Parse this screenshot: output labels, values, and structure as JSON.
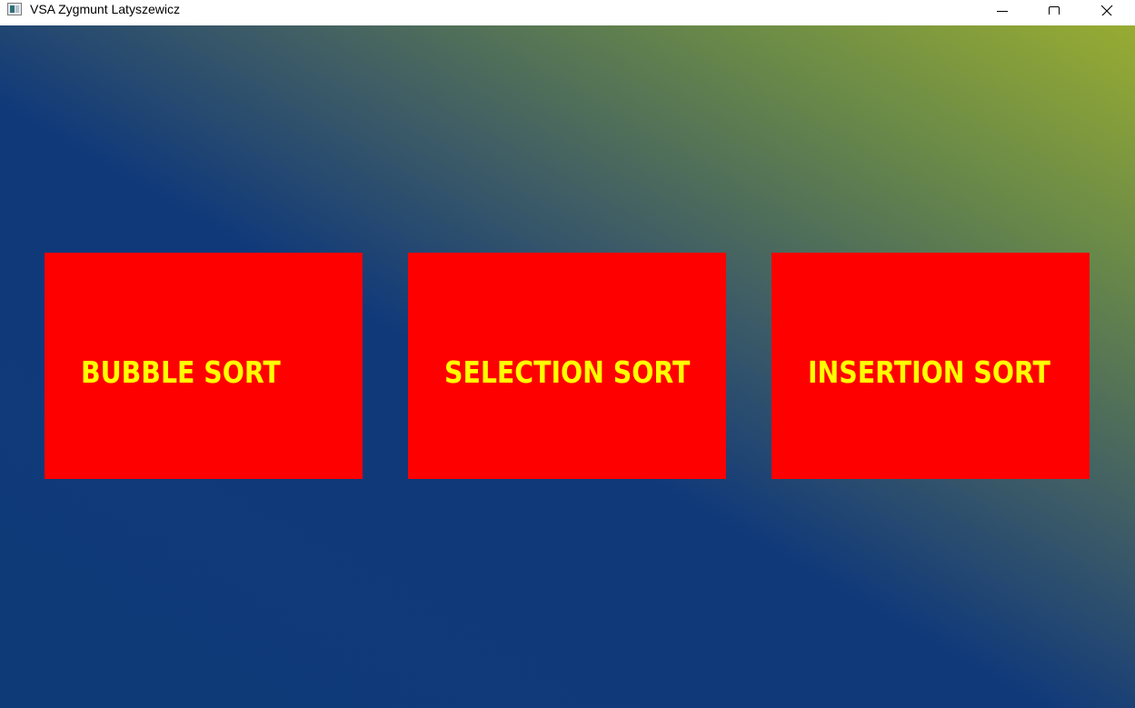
{
  "window": {
    "title": "VSA Zygmunt Latyszewicz",
    "controls": {
      "minimize_icon": "minimize-icon",
      "maximize_icon": "maximize-icon",
      "close_icon": "close-icon"
    }
  },
  "menu": {
    "buttons": [
      {
        "label": "BUBBLE SORT"
      },
      {
        "label": "SELECTION SORT"
      },
      {
        "label": "INSERTION SORT"
      }
    ]
  },
  "colors": {
    "button_background": "#ff0000",
    "button_text": "#ffff00",
    "gradient_start": "#0f3a78",
    "gradient_end": "#98ac32"
  }
}
